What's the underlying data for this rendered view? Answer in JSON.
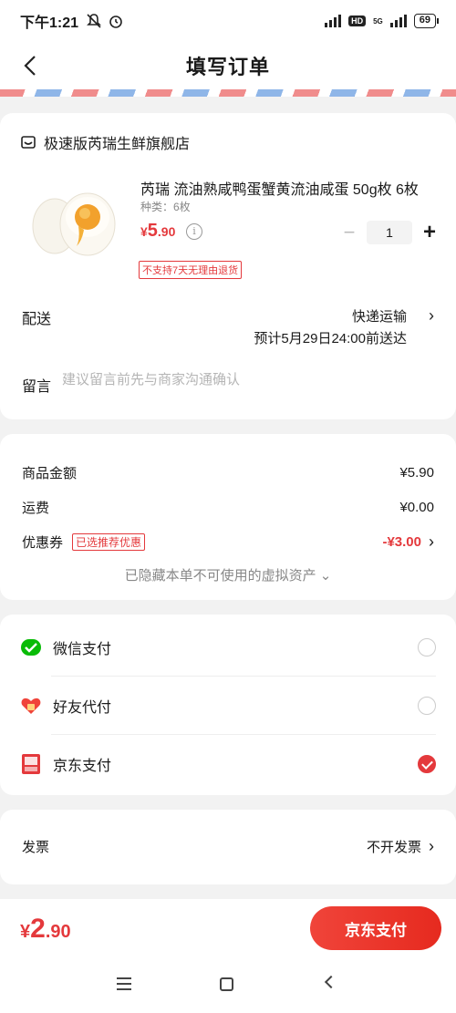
{
  "status_bar": {
    "time": "下午1:21",
    "battery": "69",
    "network": "5G",
    "hd": "HD"
  },
  "nav": {
    "title": "填写订单"
  },
  "order": {
    "shop_name": "极速版芮瑞生鲜旗舰店",
    "product": {
      "title": "芮瑞 流油熟咸鸭蛋蟹黄流油咸蛋 50g枚 6枚",
      "spec": "种类：6枚",
      "price_currency": "¥",
      "price_int": "5",
      "price_dec": ".90",
      "quantity": "1",
      "tag": "不支持7天无理由退货"
    },
    "delivery": {
      "label": "配送",
      "method": "快递运输",
      "eta": "预计5月29日24:00前送达"
    },
    "note": {
      "label": "留言",
      "placeholder": "建议留言前先与商家沟通确认"
    }
  },
  "summary": {
    "goods": {
      "label": "商品金额",
      "value": "¥5.90"
    },
    "shipping": {
      "label": "运费",
      "value": "¥0.00"
    },
    "coupon": {
      "label": "优惠券",
      "badge": "已选推荐优惠",
      "value": "-¥3.00"
    },
    "hidden_note": "已隐藏本单不可使用的虚拟资产 ⌄"
  },
  "payment": {
    "options": [
      {
        "label": "微信支付",
        "checked": false,
        "icon": "wechat-pay-icon",
        "color": "#09bb07"
      },
      {
        "label": "好友代付",
        "checked": false,
        "icon": "friend-pay-icon",
        "color": "#f0443a"
      },
      {
        "label": "京东支付",
        "checked": true,
        "icon": "jd-pay-icon",
        "color": "#e4393c"
      }
    ]
  },
  "invoice": {
    "label": "发票",
    "value": "不开发票"
  },
  "bottom": {
    "currency": "¥",
    "total_int": "2",
    "total_dec": ".90",
    "pay_button": "京东支付"
  },
  "colors": {
    "accent": "#e4393c"
  }
}
